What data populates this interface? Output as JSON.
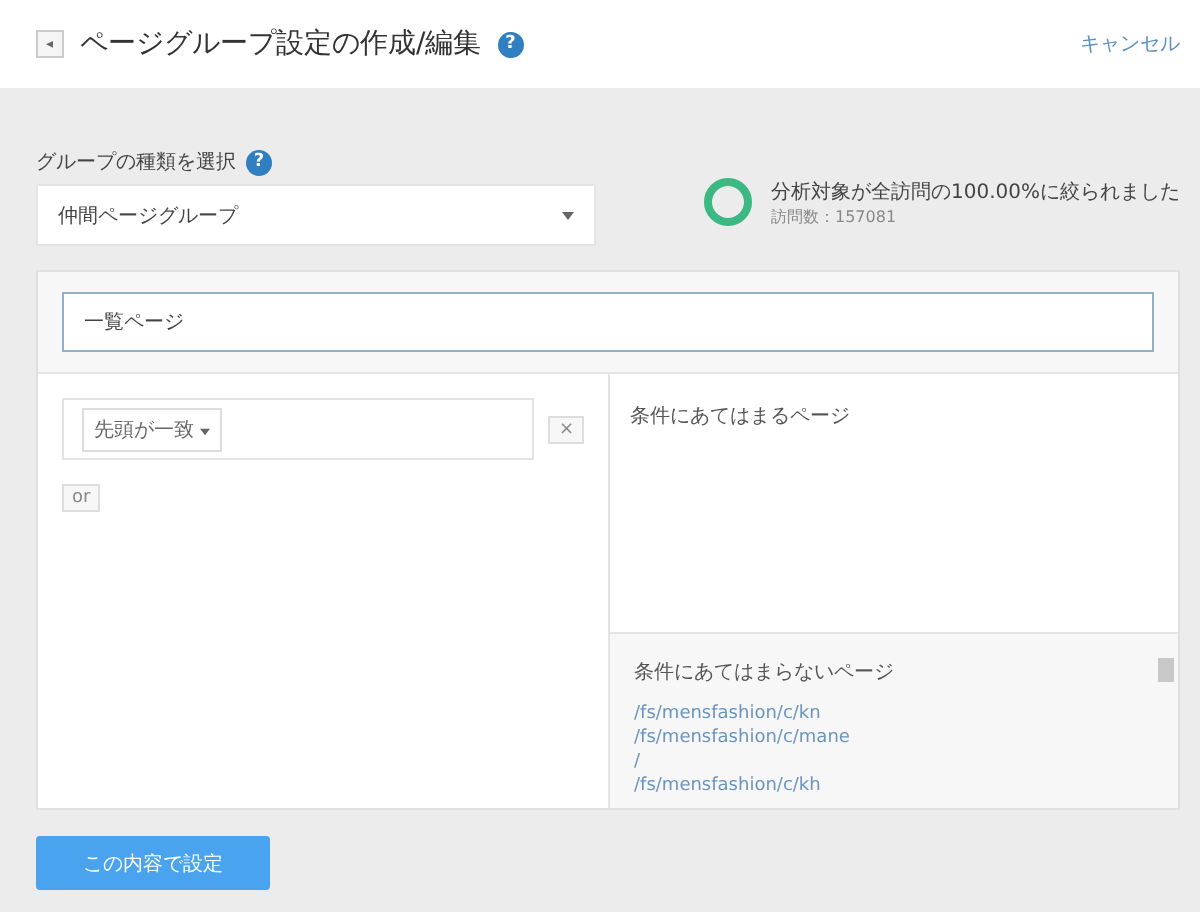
{
  "header": {
    "back_icon": "◂",
    "title": "ページグループ設定の作成/編集",
    "help": "?",
    "cancel": "キャンセル"
  },
  "group_type": {
    "label": "グループの種類を選択",
    "help": "?",
    "value": "仲間ページグループ"
  },
  "summary": {
    "message": "分析対象が全訪問の100.00%に絞られました",
    "visits": "訪問数：157081",
    "level": 1
  },
  "name_field": {
    "value": "一覧ページ"
  },
  "conditions": [
    {
      "match": "先頭が一致",
      "remove": "×"
    }
  ],
  "or_button": "or",
  "matching": {
    "title": "条件にあてはまるページ"
  },
  "not_matching": {
    "title": "条件にあてはまらないページ",
    "pages": [
      "/fs/mensfashion/c/kn",
      "/fs/mensfashion/c/mane",
      "/",
      "/fs/mensfashion/c/kh"
    ]
  },
  "submit": "この内容で設定"
}
